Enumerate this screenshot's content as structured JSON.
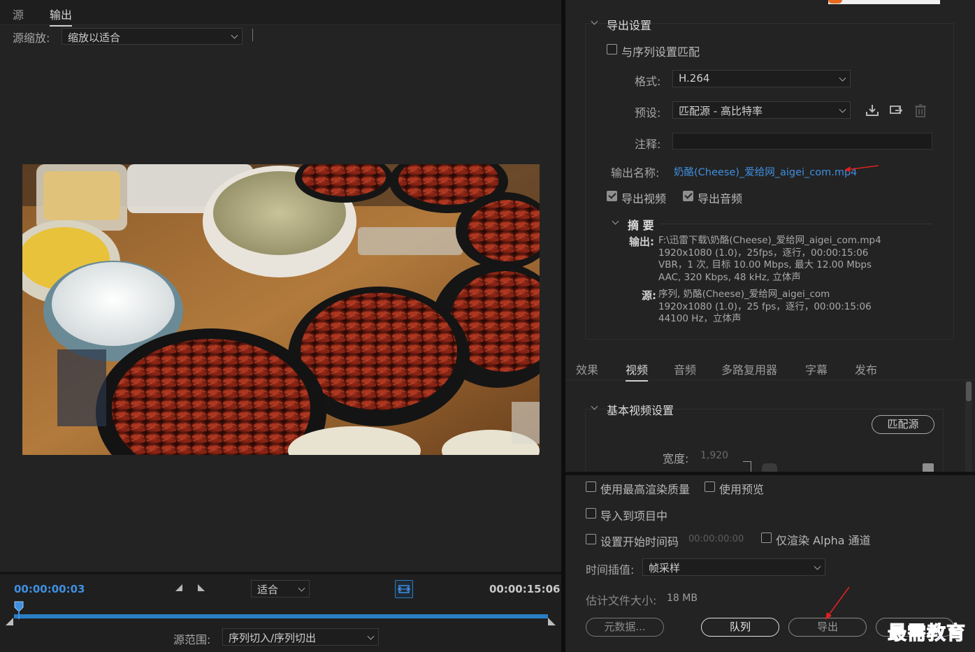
{
  "left": {
    "tabs": [
      {
        "label": "源",
        "active": false
      },
      {
        "label": "输出",
        "active": true
      }
    ],
    "source_scale_label": "源缩放:",
    "source_scale_value": "缩放以适合",
    "timecode_current": "00:00:00:03",
    "timecode_duration": "00:00:15:06",
    "fit_value": "适合",
    "source_range_label": "源范围:",
    "source_range_value": "序列切入/序列切出",
    "playhead_progress": 0.002
  },
  "export_settings": {
    "title": "导出设置",
    "match_sequence_label": "与序列设置匹配",
    "match_sequence_checked": false,
    "format_label": "格式:",
    "format_value": "H.264",
    "preset_label": "预设:",
    "preset_value": "匹配源 - 高比特率",
    "comment_label": "注释:",
    "comment_value": "",
    "output_name_label": "输出名称:",
    "output_name_value": "奶酪(Cheese)_爱给网_aigei_com.mp4",
    "export_video_label": "导出视频",
    "export_video_checked": true,
    "export_audio_label": "导出音频",
    "export_audio_checked": true
  },
  "summary": {
    "title": "摘 要",
    "output_key": "输出:",
    "output_lines": [
      "F:\\迅雷下载\\奶酪(Cheese)_爱给网_aigei_com.mp4",
      "1920x1080 (1.0)，25fps，逐行，00:00:15:06",
      "VBR，1 次, 目标 10.00 Mbps, 最大 12.00 Mbps",
      "AAC, 320 Kbps, 48  kHz, 立体声"
    ],
    "source_key": "源:",
    "source_lines": [
      "序列, 奶酪(Cheese)_爱给网_aigei_com",
      "1920x1080 (1.0)，25 fps，逐行，00:00:15:06",
      "44100 Hz，立体声"
    ]
  },
  "right_tabs": [
    {
      "label": "效果",
      "active": false
    },
    {
      "label": "视频",
      "active": true
    },
    {
      "label": "音频",
      "active": false
    },
    {
      "label": "多路复用器",
      "active": false
    },
    {
      "label": "字幕",
      "active": false
    },
    {
      "label": "发布",
      "active": false
    }
  ],
  "video_settings": {
    "title": "基本视频设置",
    "match_source_button": "匹配源",
    "width_label": "宽度:",
    "width_value": "1,920"
  },
  "options": {
    "max_render_quality": "使用最高渲染质量",
    "use_previews": "使用预览",
    "import_into_project": "导入到项目中",
    "set_start_timecode": "设置开始时间码",
    "start_timecode_value": "00:00:00:00",
    "render_alpha_only": "仅渲染 Alpha 通道",
    "time_interpolation_label": "时间插值:",
    "time_interpolation_value": "帧采样",
    "estimated_size_label": "估计文件大小:",
    "estimated_size_value": "18 MB"
  },
  "buttons": {
    "metadata": "元数据...",
    "queue": "队列",
    "export": "导出"
  },
  "watermark": "最需教育",
  "colors": {
    "accent_blue": "#2a7fc4",
    "link_blue": "#3f8fe0",
    "annotation_red": "#e02020",
    "panel_bg": "#232323"
  }
}
